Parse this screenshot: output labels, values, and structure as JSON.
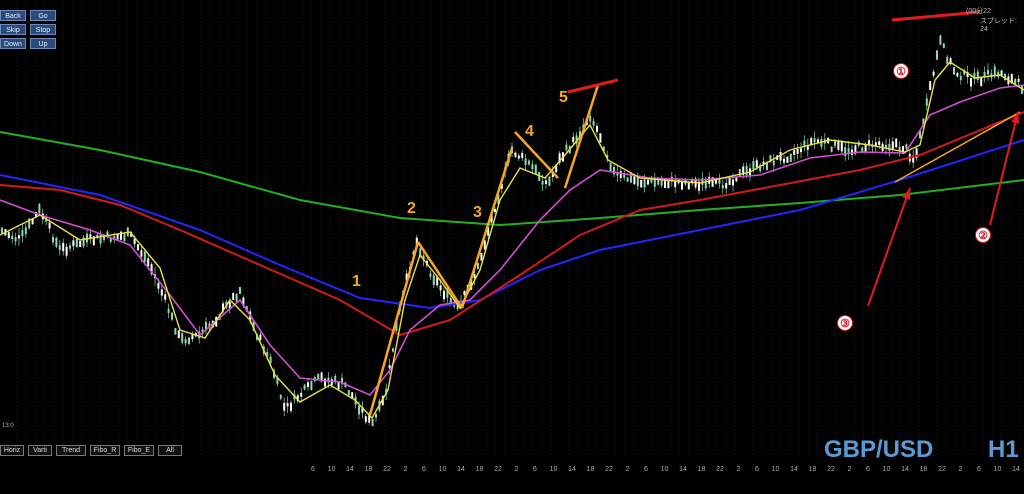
{
  "toolbar_top": [
    {
      "label": "Back"
    },
    {
      "label": "Go"
    },
    {
      "label": "Skip"
    },
    {
      "label": "Stop"
    },
    {
      "label": "Down"
    },
    {
      "label": "Up"
    }
  ],
  "toolbar_bottom": [
    {
      "label": "Horiz"
    },
    {
      "label": "Varti"
    },
    {
      "label": "Trend"
    },
    {
      "label": "Fibo_R"
    },
    {
      "label": "Fibo_E"
    },
    {
      "label": "All"
    }
  ],
  "symbol": "GBP/USD",
  "timeframe": "H1",
  "time_label": "13:0",
  "info_line1": "(00分22",
  "info_line2": "スプレッド: 24",
  "waves": [
    "1",
    "2",
    "3",
    "4",
    "5"
  ],
  "markers": [
    "①",
    "②",
    "③"
  ],
  "colors": {
    "bg": "#000000",
    "candle": "#8fd9b0",
    "ma_fast": "#e8e045",
    "ma_mid": "#d14fd0",
    "ma_red": "#d11a1a",
    "ma_blue": "#2525ff",
    "ma_green": "#22b022",
    "wave": "#f6a623",
    "annot": "#e21b1b",
    "symbol": "#5b9bd5"
  },
  "chart_data": {
    "type": "line",
    "title": "GBP/USD H1",
    "x_tick_labels": [
      "6",
      "10",
      "14",
      "18",
      "22",
      "2",
      "6",
      "10",
      "14",
      "18",
      "22",
      "2",
      "6",
      "10",
      "14",
      "18",
      "22",
      "2",
      "6",
      "10",
      "14",
      "18",
      "22",
      "2",
      "6",
      "10",
      "14",
      "18",
      "22",
      "2",
      "6",
      "10",
      "14",
      "18",
      "22",
      "2",
      "6",
      "10",
      "14",
      "18",
      "22",
      "2",
      "6",
      "10",
      "14",
      "18",
      "22",
      "2",
      "6",
      "10"
    ],
    "series": []
  }
}
